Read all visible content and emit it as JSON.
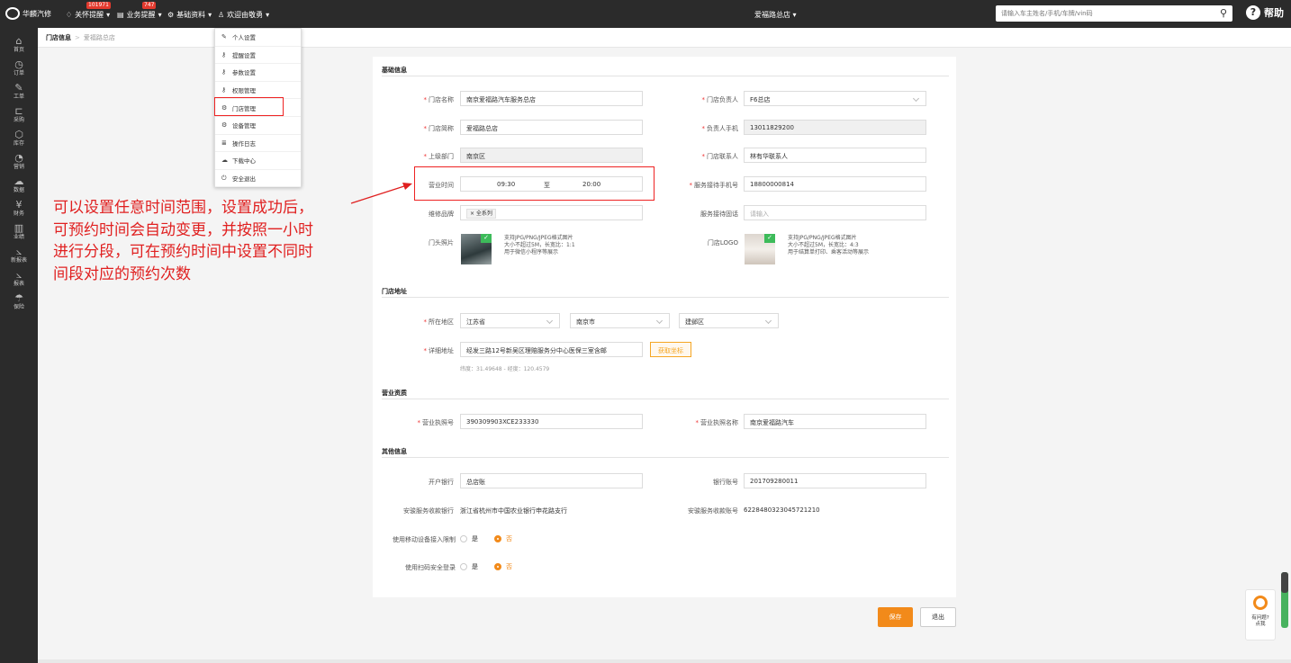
{
  "topbar": {
    "brand": "华麟汽修",
    "nav": [
      {
        "label": "关怀提醒",
        "badge": "101971",
        "icon": "bell-icon"
      },
      {
        "label": "业务提醒",
        "badge": "747",
        "icon": "doc-icon"
      },
      {
        "label": "基础资料",
        "badge": "",
        "icon": "settings-icon"
      },
      {
        "label": "欢迎由敬勇",
        "badge": "",
        "icon": "user-icon"
      }
    ],
    "store_name": "爱福路总店",
    "search_placeholder": "请输入车主姓名/手机/车牌/vin码",
    "help_label": "帮助"
  },
  "sidebar": {
    "items": [
      {
        "label": "首页",
        "icon": "home-icon"
      },
      {
        "label": "订单",
        "icon": "order-icon"
      },
      {
        "label": "工单",
        "icon": "wrench-icon"
      },
      {
        "label": "采购",
        "icon": "cart-icon"
      },
      {
        "label": "库存",
        "icon": "box-icon"
      },
      {
        "label": "营销",
        "icon": "marketing-icon"
      },
      {
        "label": "数据",
        "icon": "cloud-icon"
      },
      {
        "label": "财务",
        "icon": "yen-icon"
      },
      {
        "label": "业绩",
        "icon": "bar-chart-icon"
      },
      {
        "label": "新报表",
        "icon": "line-chart-icon"
      },
      {
        "label": "报表",
        "icon": "report-icon"
      },
      {
        "label": "保险",
        "icon": "umbrella-icon"
      }
    ]
  },
  "breadcrumb": {
    "parent": "门店信息",
    "current": "爱福路总店"
  },
  "user_menu": {
    "items": [
      {
        "label": "个人设置",
        "icon": "edit-icon"
      },
      {
        "label": "提醒设置",
        "icon": "key-icon"
      },
      {
        "label": "参数设置",
        "icon": "key-icon"
      },
      {
        "label": "权限管理",
        "icon": "key-icon"
      },
      {
        "label": "门店管理",
        "icon": "cog-icon"
      },
      {
        "label": "设备管理",
        "icon": "cog-icon"
      },
      {
        "label": "操作日志",
        "icon": "list-icon"
      },
      {
        "label": "下载中心",
        "icon": "cloud-download-icon"
      },
      {
        "label": "安全退出",
        "icon": "power-icon"
      }
    ]
  },
  "annotation": {
    "line1": "可以设置任意时间范围，设置成功后，",
    "line2": "可预约时间会自动变更，并按照一小时",
    "line3": "进行分段，可在预约时间中设置不同时",
    "line4": "间段对应的预约次数"
  },
  "form": {
    "sections": {
      "basic": "基础信息",
      "address": "门店地址",
      "license": "营业资质",
      "other": "其他信息"
    },
    "store_name_label": "门店名称",
    "store_name": "南京爱福路汽车服务总店",
    "manager_label": "门店负责人",
    "manager": "F6总店",
    "short_name_label": "门店简称",
    "short_name": "爱福路总店",
    "manager_phone_label": "负责人手机",
    "manager_phone": "13011829200",
    "parent_dept_label": "上级部门",
    "parent_dept": "南京区",
    "contact_label": "门店联系人",
    "contact": "林有华联系人",
    "hours_label": "营业时间",
    "hours_start": "09:30",
    "hours_to": "至",
    "hours_end": "20:00",
    "service_phone_label": "服务接待手机号",
    "service_phone": "18800000814",
    "brand_label": "维修品牌",
    "brand_tag": "× 全系列",
    "service_tel_label": "服务接待固话",
    "service_tel_placeholder": "请输入",
    "door_photo_label": "门头照片",
    "door_photo_hint": [
      "支持JPG/PNG/JPEG格式图片",
      "大小不超过5M，长宽比：1:1",
      "用于微信小程序等展示"
    ],
    "logo_label": "门店LOGO",
    "logo_hint": [
      "支持JPG/PNG/JPEG格式图片",
      "大小不超过5M，长宽比：4:3",
      "用于结算单打印、乘客活动等展示"
    ],
    "region_label": "所在地区",
    "province": "江苏省",
    "city": "南京市",
    "district": "建邺区",
    "address_label": "详细地址",
    "address": "经发三路12号新吴区理赔服务分中心医保三室含邮",
    "geo_button": "获取坐标",
    "coords": "纬度：31.49648 - 经度：120.4579",
    "license_no_label": "营业执照号",
    "license_no": "390309903XCE233330",
    "license_name_label": "营业执照名称",
    "license_name": "南京爱福路汽车",
    "bank_label": "开户银行",
    "bank": "总店账",
    "bank_account_label": "银行账号",
    "bank_account": "201709280011",
    "anxin_bank_label": "安骏服务收款银行",
    "anxin_bank": "浙江省杭州市中国农业银行申花路支行",
    "anxin_account_label": "安骏服务收款账号",
    "anxin_account": "6228480323045721210",
    "mobile_limit_label": "使用移动设备接入限制",
    "scan_login_label": "使用扫码安全登录",
    "yes": "是",
    "no": "否",
    "save_button": "保存",
    "exit_button": "退出"
  },
  "float_widget": {
    "line1": "有问题?",
    "line2": "点我"
  },
  "colors": {
    "accent": "#f28a1a",
    "annotation": "#e02020",
    "topbar": "#2b2b2b"
  }
}
